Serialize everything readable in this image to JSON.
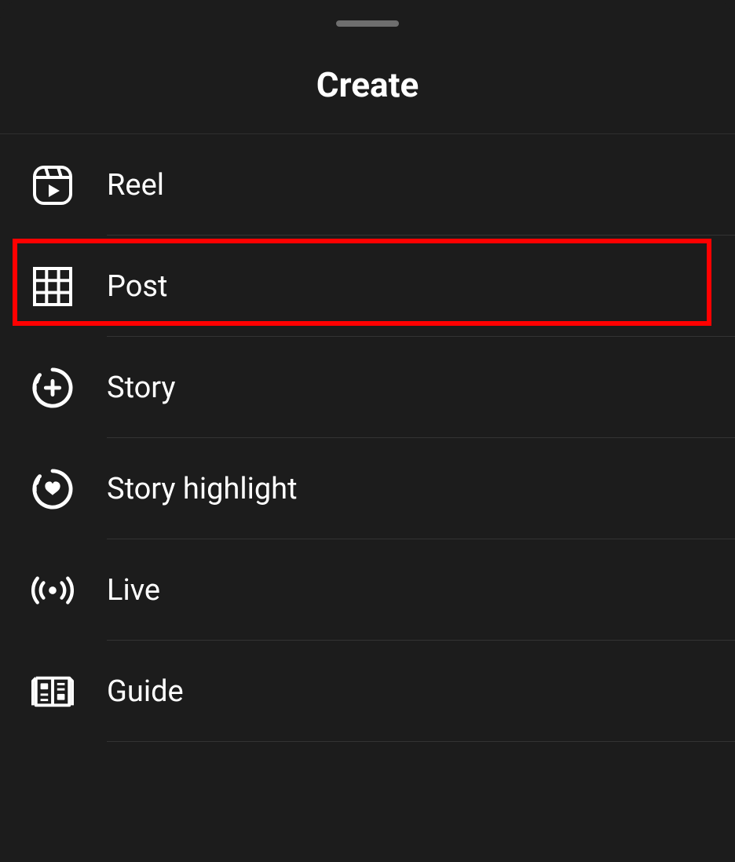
{
  "header": {
    "title": "Create"
  },
  "menu": {
    "items": [
      {
        "label": "Reel",
        "icon": "reel-icon"
      },
      {
        "label": "Post",
        "icon": "grid-icon"
      },
      {
        "label": "Story",
        "icon": "story-add-icon"
      },
      {
        "label": "Story highlight",
        "icon": "story-heart-icon"
      },
      {
        "label": "Live",
        "icon": "live-icon"
      },
      {
        "label": "Guide",
        "icon": "guide-icon"
      }
    ]
  },
  "highlight": {
    "item_index": 1
  }
}
